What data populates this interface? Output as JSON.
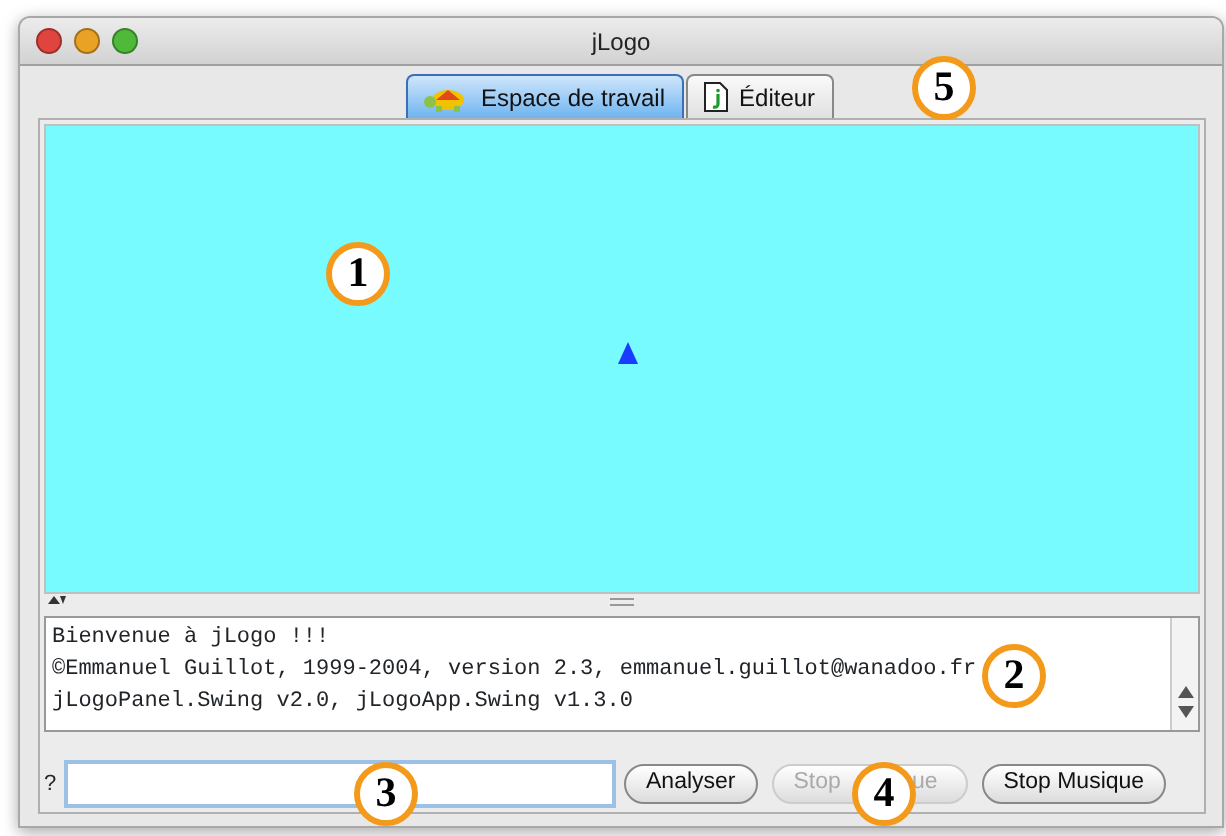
{
  "window": {
    "title": "jLogo"
  },
  "tabs": [
    {
      "label": "Espace de travail",
      "kind": "turtle",
      "selected": true
    },
    {
      "label": "Éditeur",
      "kind": "document",
      "selected": false
    }
  ],
  "console": {
    "lines": [
      "Bienvenue à jLogo !!!",
      "©Emmanuel Guillot, 1999-2004, version 2.3, emmanuel.guillot@wanadoo.fr",
      "jLogoPanel.Swing v2.0, jLogoApp.Swing v1.3.0"
    ]
  },
  "command": {
    "prompt": "?"
  },
  "buttons": [
    {
      "label": "Analyser",
      "disabled": false
    },
    {
      "label_start": "Stop",
      "label_end": "ue",
      "disabled": true
    },
    {
      "label": "Stop Musique",
      "disabled": false
    }
  ],
  "callouts": [
    "1",
    "2",
    "3",
    "4",
    "5"
  ]
}
